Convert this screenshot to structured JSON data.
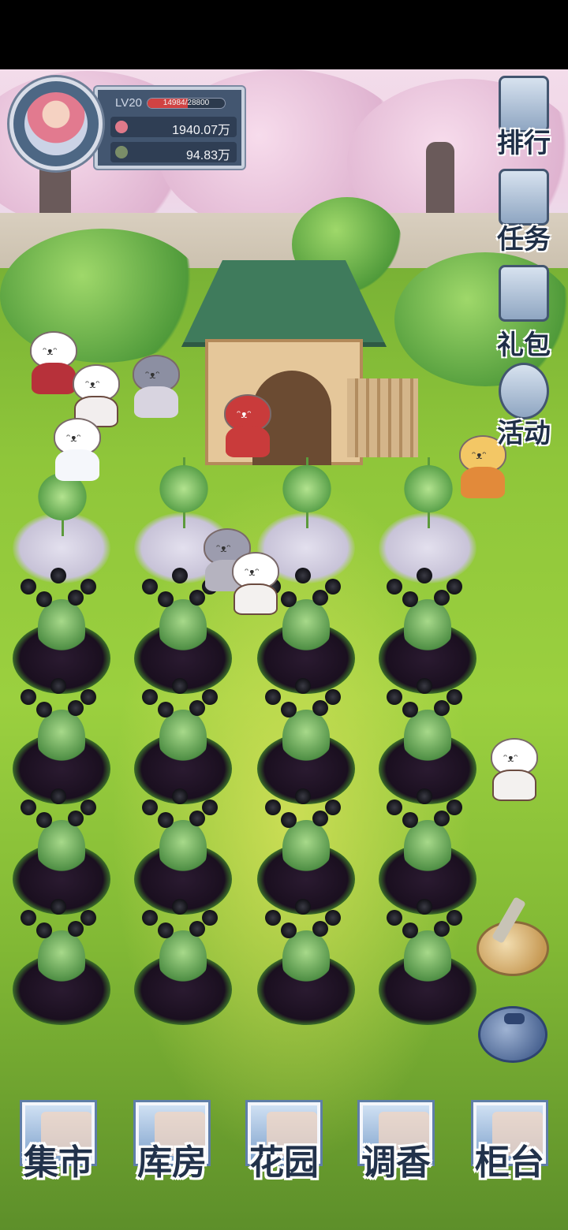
{
  "player": {
    "level": "LV20",
    "exp": "14984/28800",
    "exp_fraction": 0.52,
    "petals": "1940.07万",
    "leaves": "94.83万"
  },
  "side_menu": [
    {
      "label": "排行",
      "icon": "ranking-book-icon"
    },
    {
      "label": "任务",
      "icon": "task-clipboard-icon"
    },
    {
      "label": "礼包",
      "icon": "gift-box-icon"
    },
    {
      "label": "活动",
      "icon": "event-balloon-icon"
    }
  ],
  "tools": [
    {
      "icon": "shovel-icon"
    },
    {
      "icon": "seed-bag-icon"
    }
  ],
  "bottom_nav": [
    {
      "label": "集市",
      "icon": "market-gate-icon"
    },
    {
      "label": "库房",
      "icon": "warehouse-icon"
    },
    {
      "label": "花园",
      "icon": "garden-rose-icon"
    },
    {
      "label": "调香",
      "icon": "perfume-icon"
    },
    {
      "label": "柜台",
      "icon": "counter-icon"
    }
  ],
  "colors": {
    "panel": "#435670",
    "xp_fill": "#d04343",
    "lawn": "#8fc63a",
    "soil": "#1a0f1f",
    "house_roof": "#3f7b5c"
  }
}
